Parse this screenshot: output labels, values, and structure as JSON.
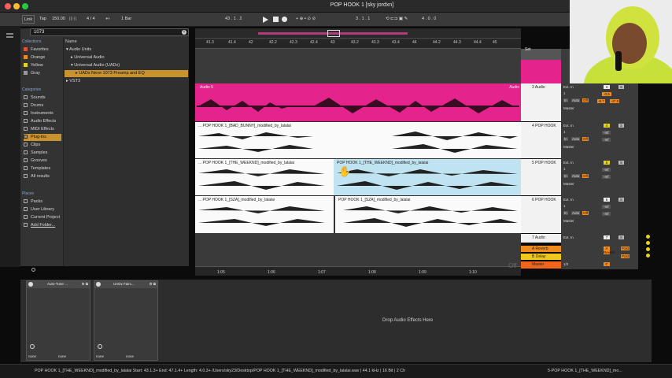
{
  "window": {
    "title": "POP HOOK 1  [sky jordxn]"
  },
  "transport": {
    "link": "Link",
    "tap": "Tap",
    "tempo": "150.00",
    "signature": "4 / 4",
    "quantize": "1 Bar",
    "position": "43 .  1 .  2",
    "loop_start": "3 .  1 .  1",
    "loop_length": "4 .  0 .  0"
  },
  "browser": {
    "search_value": "1073",
    "collections_header": "Collections",
    "collections": [
      "Favorites",
      "Orange",
      "Yellow",
      "Gray"
    ],
    "categories_header": "Categories",
    "categories": [
      "Sounds",
      "Drums",
      "Instruments",
      "Audio Effects",
      "MIDI Effects",
      "Plug-ins",
      "Clips",
      "Samples",
      "Grooves",
      "Templates",
      "All results"
    ],
    "places_header": "Places",
    "places": [
      "Packs",
      "User Library",
      "Current Project",
      "Add Folder..."
    ],
    "column_header": "Name",
    "tree": [
      "Audio Units",
      "Universal Audio",
      "Universal Audio (UADx)",
      "UADx Neve 1073 Preamp and EQ",
      "VST3"
    ]
  },
  "arrangement": {
    "ruler": [
      "41.3",
      "41.4",
      "42",
      "42.2",
      "42.3",
      "42.4",
      "43",
      "43.2",
      "43.3",
      "43.4",
      "44",
      "44.2",
      "44.3",
      "44.4",
      "45"
    ],
    "time_ruler": [
      "1:05",
      "1:06",
      "1:07",
      "1:08",
      "1:09",
      "1:10"
    ],
    "clips": {
      "audio5": "Audio 5",
      "bad_bunny": "... POP HOOK 1_[BAD_BUNNY]_modified_by_lalalai",
      "weeknd_a": "... POP HOOK 1_[THE_WEEKND]_modified_by_lalalai",
      "weeknd_b": "POP HOOK 1_[THE_WEEKND]_modified_by_lalalai",
      "sza_a": "... POP HOOK 1_[SZA]_modified_by_lalalai",
      "sza_b": "POP HOOK 1_[SZA]_modified_by_lalalai",
      "audio_right": "Audio"
    }
  },
  "tracks": [
    {
      "name": "3 Audio",
      "number": "3"
    },
    {
      "name": "4 POP HOOK",
      "number": "4"
    },
    {
      "name": "5 POP HOOK",
      "number": "5"
    },
    {
      "name": "6 POP HOOK",
      "number": "6"
    },
    {
      "name": "7 Audio",
      "number": "7"
    }
  ],
  "returns": [
    "A Reverb",
    "B Delay",
    "Master"
  ],
  "mixer": {
    "set_label": "Set",
    "input": "Ext. In",
    "input_ch": "1",
    "monitor_in": "In",
    "monitor_auto": "Auto",
    "monitor_off": "Off",
    "output": "Master",
    "solo": "S",
    "post": "Post",
    "vol_neg_inf": "-Inf",
    "pan_c": "C",
    "ratio": "1/2",
    "track3_vol": "-0.6",
    "track3_val1": "-8.7",
    "track3_val2": "-47.0"
  },
  "devices": [
    {
      "name": "Auto-Tune ...",
      "preset": "none",
      "preset2": "none"
    },
    {
      "name": "UADx Fairc...",
      "preset": "none",
      "preset2": "none"
    }
  ],
  "drop_text": "Drop Audio Effects Here",
  "status": {
    "left": "POP HOOK 1_[THE_WEEKND]_modified_by_lalalai  Start: 43.1.3+  End: 47.1.4+  Length: 4.0.3+  /Users/sky23/Desktop/POP HOOK 1_[THE_WEEKND]_modified_by_lalalai.wav | 44.1 kHz | 16 Bit | 2 Ch",
    "right": "5-POP HOOK 1_[THE_WEEKND]_mo..."
  },
  "off_label": "Off",
  "colors": {
    "pink": "#e5238c",
    "lightblue": "#bfe3f0",
    "orange": "#f08a1c",
    "selection": "#c8922e"
  }
}
